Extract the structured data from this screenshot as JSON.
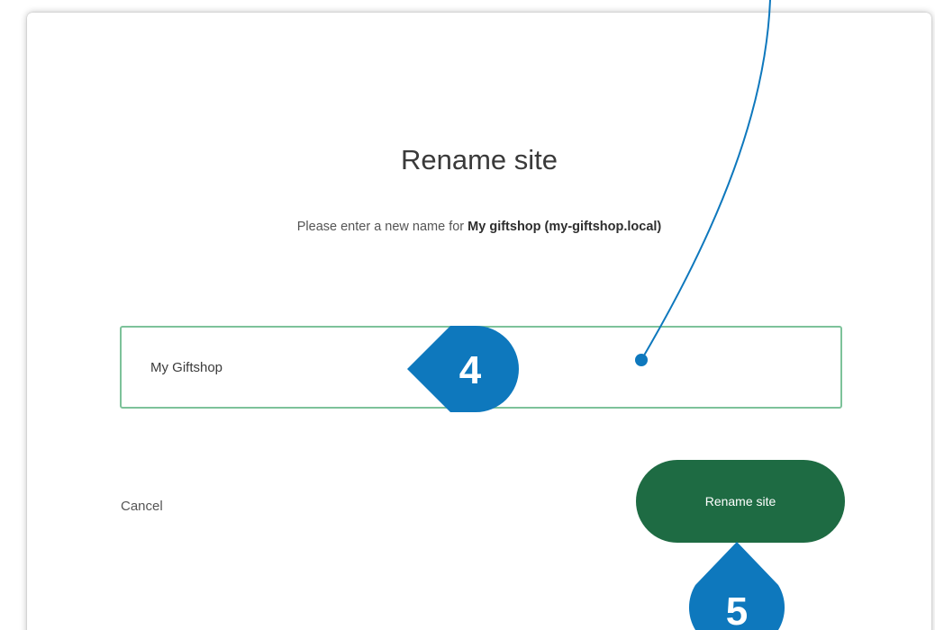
{
  "dialog": {
    "title": "Rename site",
    "subtitle_prefix": "Please enter a new name for ",
    "subtitle_site": "My giftshop (my-giftshop.local)",
    "name_input": {
      "value": "My Giftshop"
    },
    "cancel_label": "Cancel",
    "rename_label": "Rename site"
  },
  "annotations": {
    "step_input": "4",
    "step_button": "5"
  },
  "colors": {
    "button": "#1e6b43",
    "input_border": "#7dc29a",
    "annotation": "#0e78bd"
  }
}
